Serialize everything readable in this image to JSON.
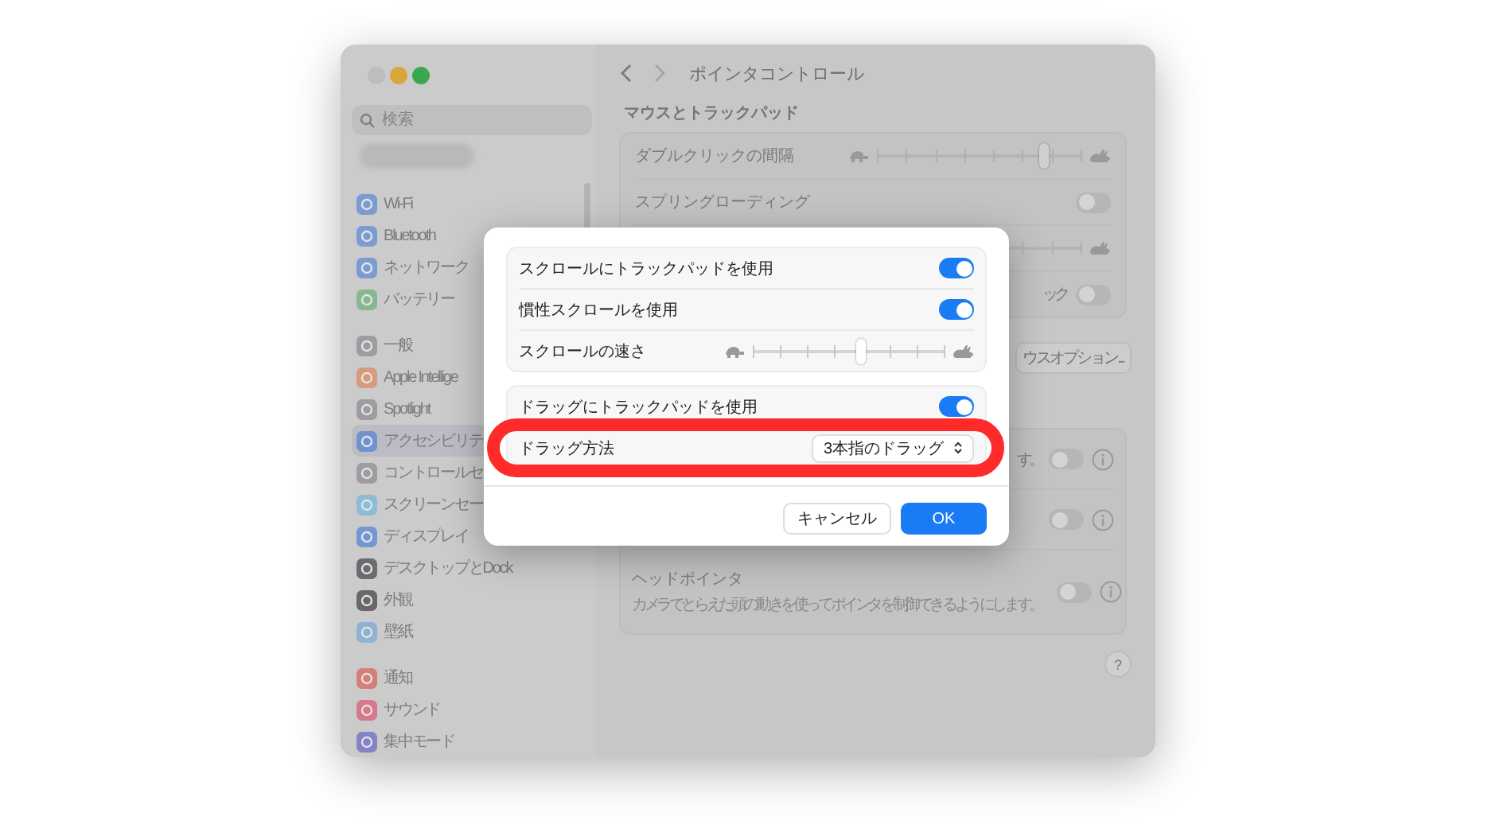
{
  "sidebar": {
    "search": {
      "placeholder": "検索"
    },
    "groups": [
      [
        {
          "label": "Wi-Fi",
          "color": "#7c9bd0",
          "selected": false
        },
        {
          "label": "Bluetooth",
          "color": "#7c9bd0",
          "selected": false
        },
        {
          "label": "ネットワーク",
          "color": "#7c9bd0",
          "selected": false
        },
        {
          "label": "バッテリー",
          "color": "#85b88f",
          "selected": false
        }
      ],
      [
        {
          "label": "一般",
          "color": "#9d9da1",
          "selected": false
        },
        {
          "label": "Apple Intellige",
          "color": "#d69a7c",
          "selected": false
        },
        {
          "label": "Spotlight",
          "color": "#9d9da1",
          "selected": false
        },
        {
          "label": "アクセシビリテ",
          "color": "#6f93cf",
          "selected": true
        },
        {
          "label": "コントロールセ",
          "color": "#9d9da1",
          "selected": false
        },
        {
          "label": "スクリーンセー",
          "color": "#8cbcd6",
          "selected": false
        },
        {
          "label": "ディスプレイ",
          "color": "#7497d2",
          "selected": false
        },
        {
          "label": "デスクトップとDock",
          "color": "#6c6c70",
          "selected": false
        },
        {
          "label": "外観",
          "color": "#68686b",
          "selected": false
        },
        {
          "label": "壁紙",
          "color": "#8fb2d4",
          "selected": false
        }
      ],
      [
        {
          "label": "通知",
          "color": "#d57f7a",
          "selected": false
        },
        {
          "label": "サウンド",
          "color": "#d6798d",
          "selected": false
        },
        {
          "label": "集中モード",
          "color": "#8583c7",
          "selected": false
        }
      ]
    ]
  },
  "page": {
    "title": "ポインタコントロール",
    "section": "マウスとトラックパッド",
    "card1": [
      {
        "kind": "slider",
        "label": "ダブルクリックの間隔",
        "level": 0.82
      },
      {
        "kind": "toggle",
        "label": "スプリングローディング",
        "on": false
      },
      {
        "kind": "slider"
      },
      {
        "kind": "toggle",
        "tail": "ック",
        "on": false
      }
    ],
    "button": "ウスオプション...",
    "card2": [
      {
        "kind": "toggle",
        "tail": "す。",
        "on": false,
        "info": true
      },
      {
        "kind": "toggle",
        "on": false,
        "info": true
      },
      {
        "kind": "toggle",
        "label": "ヘッドポインタ",
        "description": "カメラでとらえた頭の動きを使ってポインタを制御できるようにします。",
        "on": false,
        "info": true
      }
    ],
    "help": "?"
  },
  "dialog": {
    "groups": [
      [
        {
          "kind": "toggle",
          "label": "スクロールにトラックパッドを使用",
          "on": true
        },
        {
          "kind": "toggle",
          "label": "慣性スクロールを使用",
          "on": true
        },
        {
          "kind": "slider",
          "label": "スクロールの速さ",
          "level": 0.57
        }
      ],
      [
        {
          "kind": "toggle",
          "label": "ドラッグにトラックパッドを使用",
          "on": true
        },
        {
          "kind": "popup",
          "label": "ドラッグ方法",
          "value": "3本指のドラッグ"
        }
      ]
    ],
    "buttons": [
      {
        "label": "キャンセル",
        "kind": "secondary"
      },
      {
        "label": "OK",
        "kind": "primary"
      }
    ],
    "annotation": {
      "kind": "ring",
      "color": "#ff2a2a"
    }
  }
}
